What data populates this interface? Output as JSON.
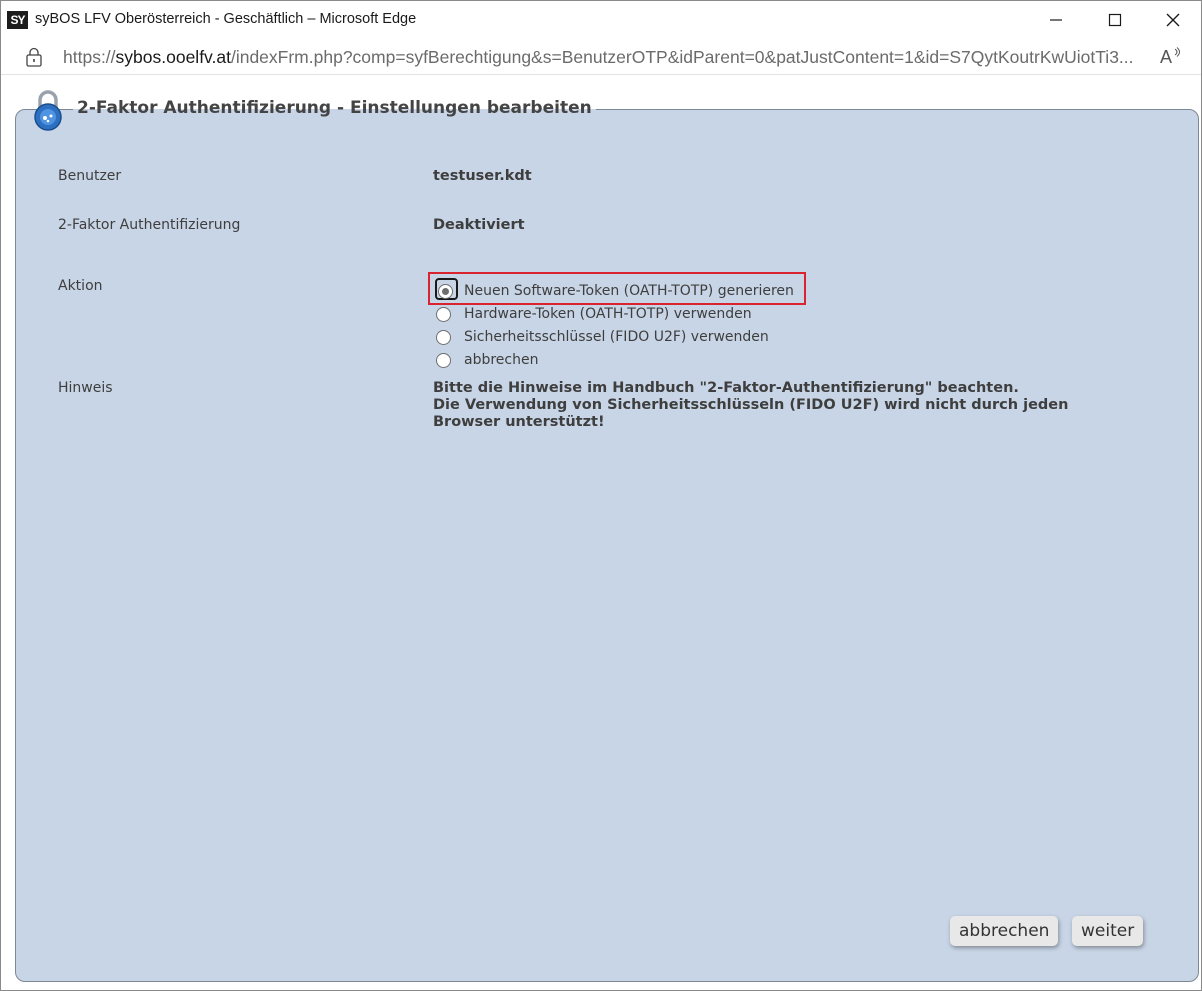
{
  "window": {
    "title": "syBOS LFV Oberösterreich - Geschäftlich – Microsoft Edge",
    "app_logo_text": "SY",
    "url_prefix": "https://",
    "url_host": "sybos.ooelfv.at",
    "url_path": "/indexFrm.php?comp=syfBerechtigung&s=BenutzerOTP&idParent=0&patJustContent=1&id=S7QytKoutrKwUiotTi3...",
    "read_aloud_glyph": "A"
  },
  "panel": {
    "title": "2-Faktor Authentifizierung - Einstellungen bearbeiten",
    "rows": {
      "user_label": "Benutzer",
      "user_value": "testuser.kdt",
      "twofa_label": "2-Faktor Authentifizierung",
      "twofa_value": "Deaktiviert",
      "action_label": "Aktion",
      "hint_label": "Hinweis"
    },
    "actions": [
      {
        "label": "Neuen Software-Token (OATH-TOTP) generieren",
        "checked": true
      },
      {
        "label": "Hardware-Token (OATH-TOTP) verwenden",
        "checked": false
      },
      {
        "label": "Sicherheitsschlüssel (FIDO U2F) verwenden",
        "checked": false
      },
      {
        "label": "abbrechen",
        "checked": false
      }
    ],
    "hint_lines": [
      "Bitte die Hinweise im Handbuch \"2-Faktor-Authentifizierung\" beachten.",
      "Die Verwendung von Sicherheitsschlüsseln (FIDO U2F) wird nicht durch jeden",
      "Browser unterstützt!"
    ]
  },
  "buttons": {
    "cancel_label": "abbrechen",
    "next_label": "weiter"
  },
  "colors": {
    "panel_bg": "#c8d5e6",
    "highlight": "#d9232e"
  }
}
